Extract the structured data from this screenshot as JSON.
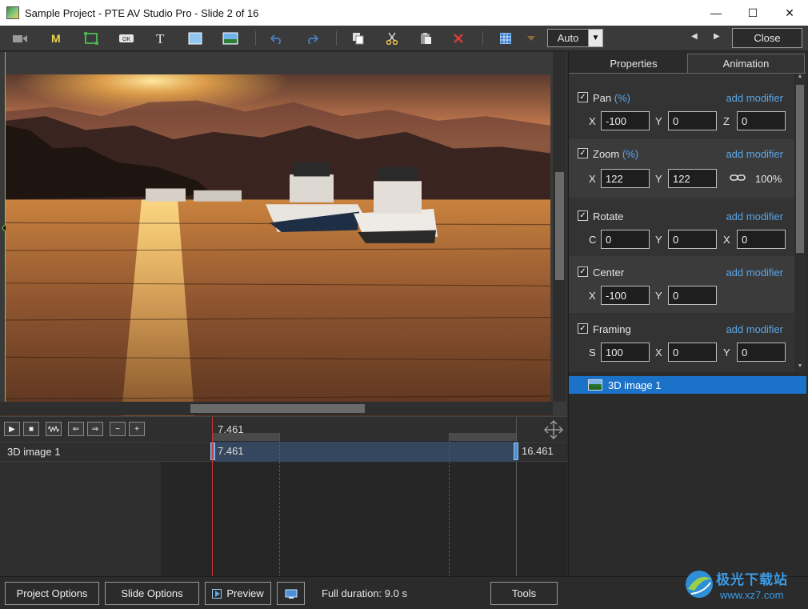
{
  "window": {
    "title": "Sample Project - PTE AV Studio Pro - Slide 2 of 16",
    "minimize": "—",
    "maximize": "☐",
    "close": "✕"
  },
  "toolbar": {
    "mode_select": "Auto",
    "close_label": "Close",
    "prev": "◀",
    "next": "▶",
    "icons": [
      "camera-icon",
      "mask-icon",
      "frame-icon",
      "button-icon",
      "text-icon",
      "rectangle-icon",
      "image-icon",
      "undo-icon",
      "redo-icon",
      "copy-icon",
      "cut-icon",
      "paste-icon",
      "delete-icon",
      "grid-icon",
      "grid-dropdown-icon"
    ]
  },
  "tabs": {
    "properties": "Properties",
    "animation": "Animation"
  },
  "animation": {
    "add_modifier": "add modifier",
    "pan": {
      "label": "Pan",
      "unit": "(%)",
      "checked": true,
      "fields": [
        {
          "label": "X",
          "value": "-100"
        },
        {
          "label": "Y",
          "value": "0"
        },
        {
          "label": "Z",
          "value": "0"
        }
      ]
    },
    "zoom": {
      "label": "Zoom",
      "unit": "(%)",
      "checked": true,
      "fields": [
        {
          "label": "X",
          "value": "122"
        },
        {
          "label": "Y",
          "value": "122"
        }
      ],
      "ratio": "100%"
    },
    "rotate": {
      "label": "Rotate",
      "checked": true,
      "fields": [
        {
          "label": "C",
          "value": "0"
        },
        {
          "label": "Y",
          "value": "0"
        },
        {
          "label": "X",
          "value": "0"
        }
      ]
    },
    "center": {
      "label": "Center",
      "checked": true,
      "fields": [
        {
          "label": "X",
          "value": "-100"
        },
        {
          "label": "Y",
          "value": "0"
        }
      ]
    },
    "framing": {
      "label": "Framing",
      "checked": true,
      "fields": [
        {
          "label": "S",
          "value": "100"
        },
        {
          "label": "X",
          "value": "0"
        },
        {
          "label": "Y",
          "value": "0"
        }
      ]
    }
  },
  "objects": [
    {
      "name": "3D image 1",
      "selected": true
    }
  ],
  "timeline": {
    "cursor_time": "7.461",
    "track_label": "3D image 1",
    "start_time": "7.461",
    "end_time": "16.461",
    "buttons": [
      "play-icon",
      "stop-icon",
      "waveform-icon",
      "left-arrow-icon",
      "right-arrow-icon",
      "minus-icon",
      "plus-icon"
    ]
  },
  "bottom": {
    "project_options": "Project Options",
    "slide_options": "Slide Options",
    "preview": "Preview",
    "full_duration": "Full duration: 9.0 s",
    "tools": "Tools"
  },
  "watermark": {
    "line1": "极光下载站",
    "line2": "www.xz7.com"
  },
  "colors": {
    "accent": "#1a73c9",
    "link": "#5aa6e8",
    "timeline_cursor": "#d23232"
  }
}
